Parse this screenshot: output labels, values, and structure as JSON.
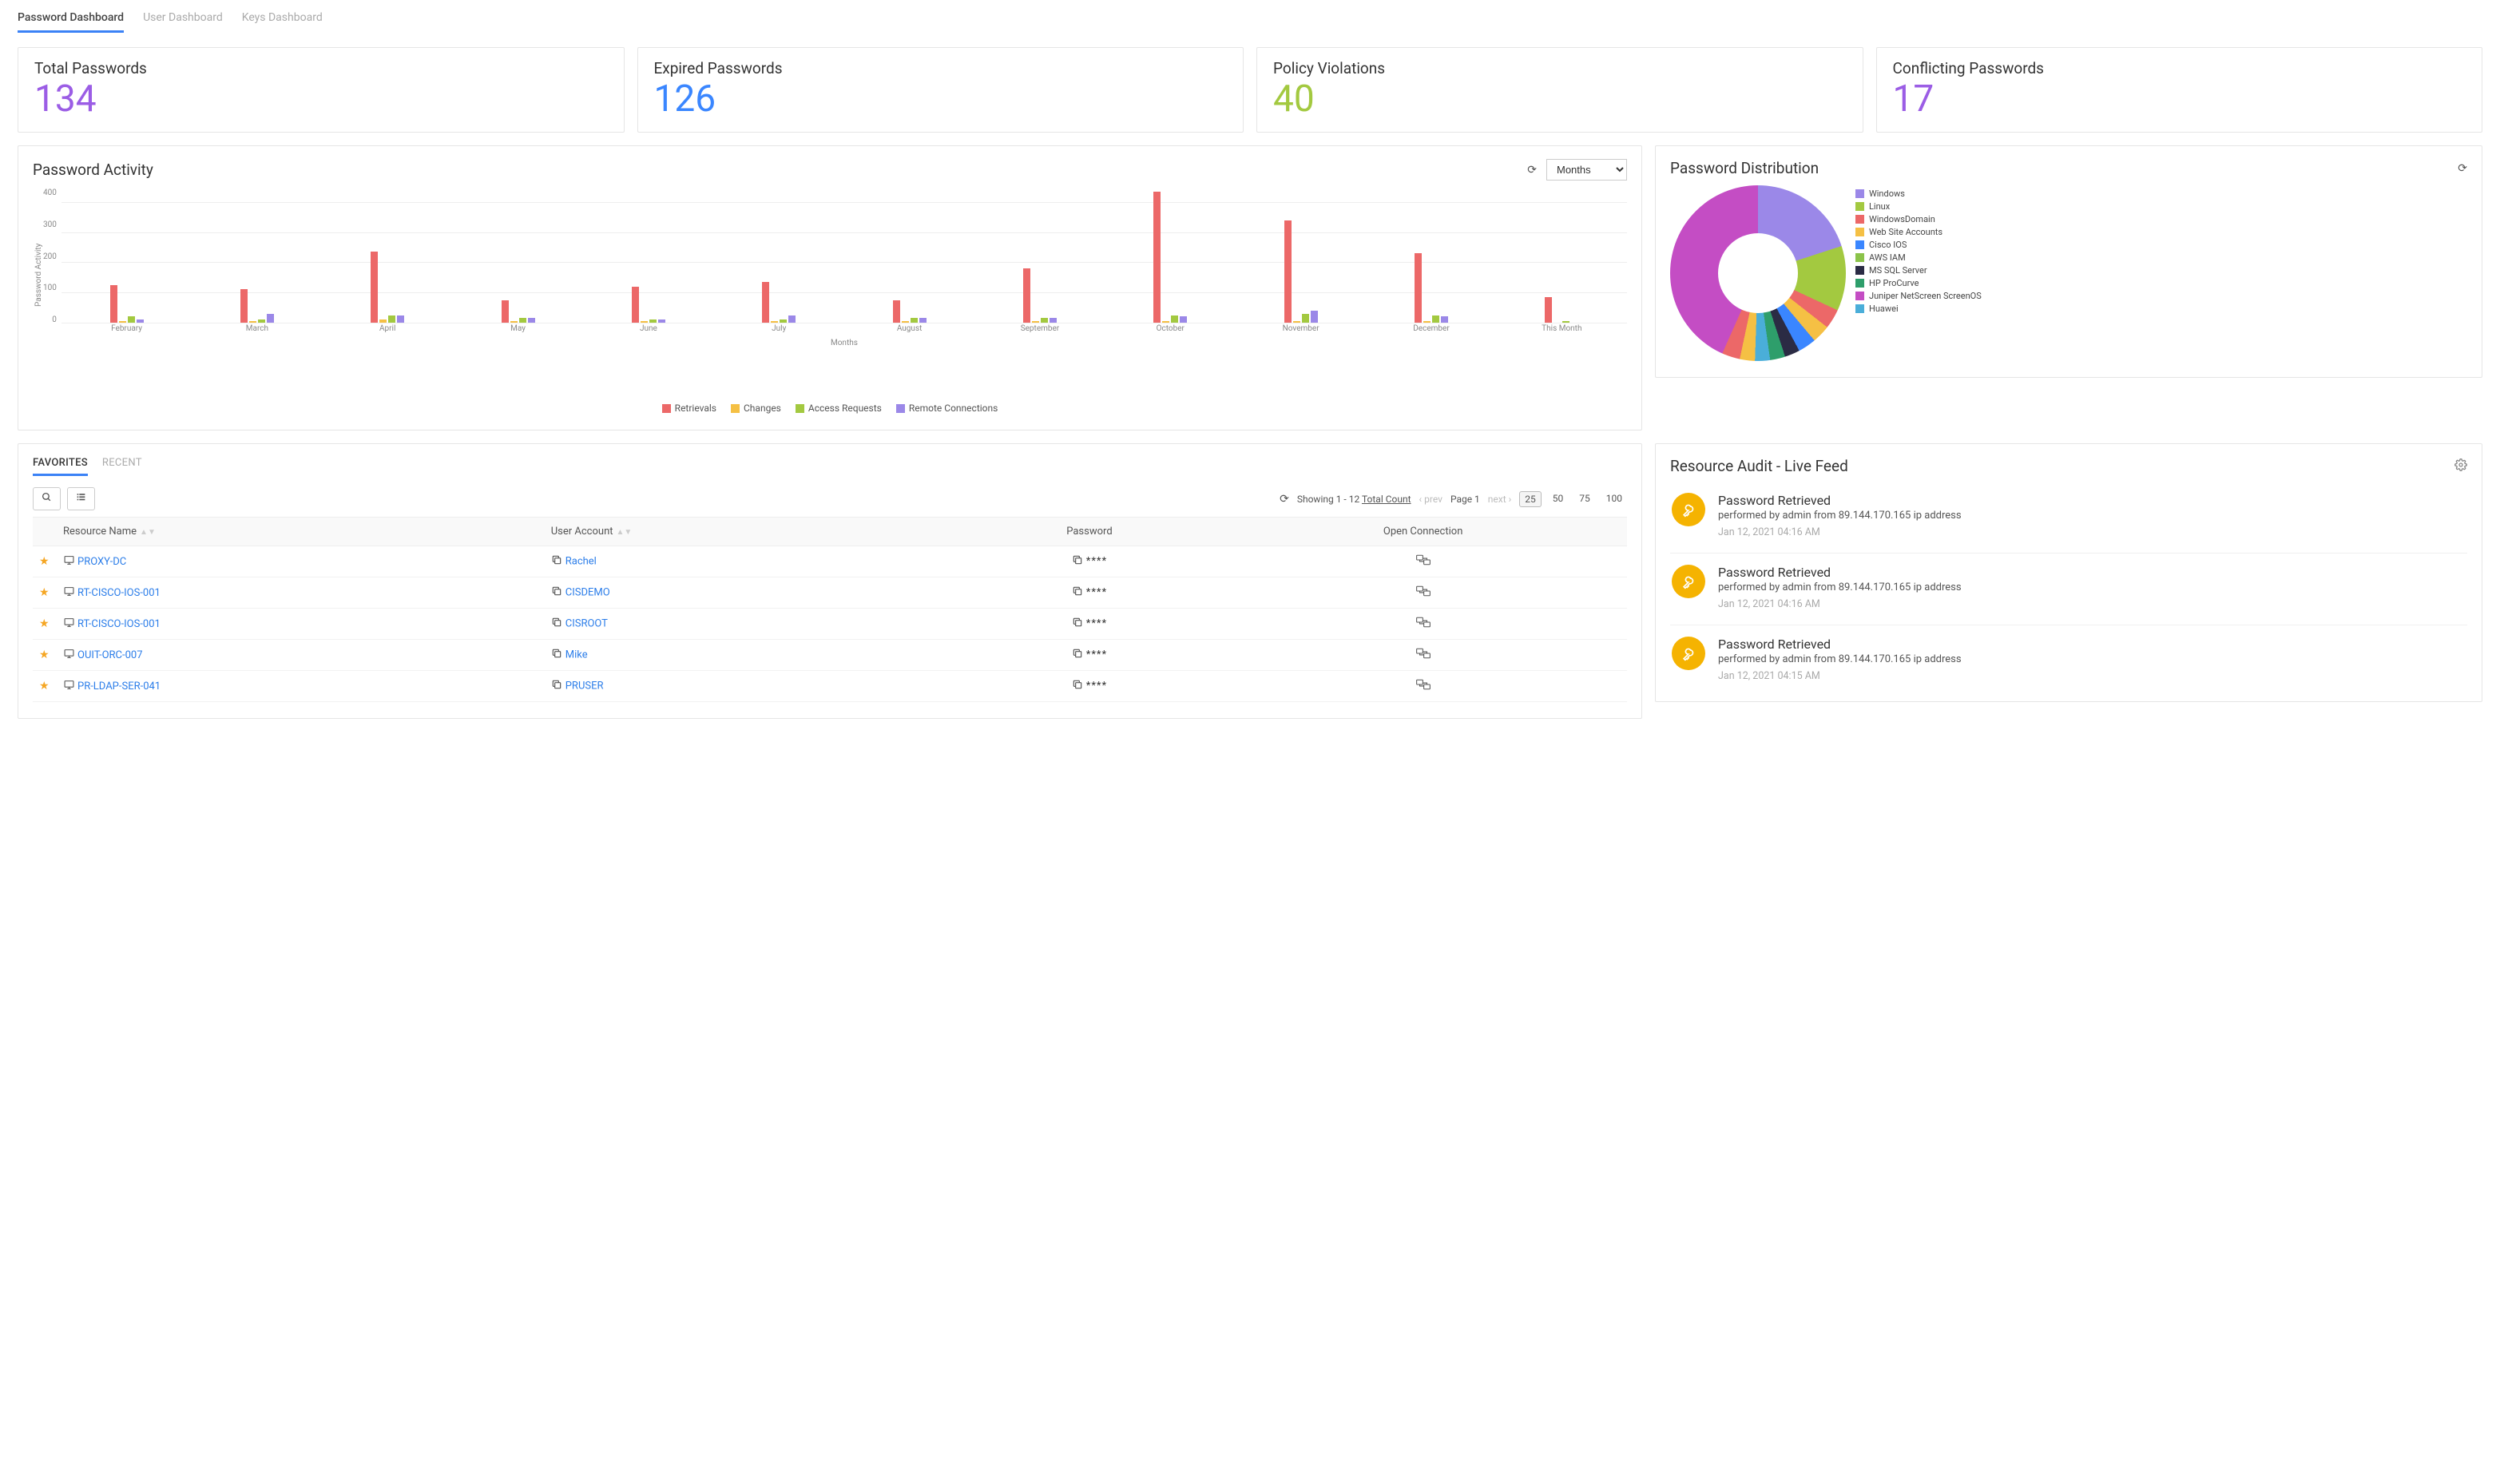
{
  "tabs": [
    "Password Dashboard",
    "User Dashboard",
    "Keys Dashboard"
  ],
  "stats": [
    {
      "label": "Total Passwords",
      "value": "134",
      "color": "c-purple"
    },
    {
      "label": "Expired Passwords",
      "value": "126",
      "color": "c-blue"
    },
    {
      "label": "Policy Violations",
      "value": "40",
      "color": "c-green"
    },
    {
      "label": "Conflicting Passwords",
      "value": "17",
      "color": "c-violet"
    }
  ],
  "activity": {
    "title": "Password Activity",
    "selector": "Months"
  },
  "chart_data": {
    "type": "bar",
    "title": "Password Activity",
    "xlabel": "Months",
    "ylabel": "Password Activity",
    "ylim": [
      0,
      450
    ],
    "yticks": [
      0,
      100,
      200,
      300,
      400
    ],
    "categories": [
      "February",
      "March",
      "April",
      "May",
      "June",
      "July",
      "August",
      "September",
      "October",
      "November",
      "December",
      "This Month"
    ],
    "series": [
      {
        "name": "Retrievals",
        "color": "#ec6868",
        "values": [
          125,
          110,
          235,
          75,
          120,
          135,
          75,
          180,
          435,
          340,
          230,
          85
        ]
      },
      {
        "name": "Changes",
        "color": "#f5c044",
        "values": [
          5,
          5,
          10,
          5,
          5,
          5,
          5,
          5,
          5,
          5,
          5,
          0
        ]
      },
      {
        "name": "Access Requests",
        "color": "#a3c940",
        "values": [
          20,
          10,
          25,
          15,
          10,
          10,
          15,
          15,
          25,
          30,
          25,
          5
        ]
      },
      {
        "name": "Remote Connections",
        "color": "#9b88e8",
        "values": [
          10,
          30,
          25,
          15,
          10,
          25,
          15,
          15,
          20,
          40,
          20,
          0
        ]
      }
    ]
  },
  "distribution": {
    "title": "Password Distribution",
    "legend": [
      {
        "label": "Windows",
        "color": "#9b88e8"
      },
      {
        "label": "Linux",
        "color": "#a3c940"
      },
      {
        "label": "WindowsDomain",
        "color": "#ec6868"
      },
      {
        "label": "Web Site Accounts",
        "color": "#f5c044"
      },
      {
        "label": "Cisco IOS",
        "color": "#3a86ff"
      },
      {
        "label": "AWS IAM",
        "color": "#8bc34a"
      },
      {
        "label": "MS SQL Server",
        "color": "#2b2b44"
      },
      {
        "label": "HP ProCurve",
        "color": "#2e9e6b"
      },
      {
        "label": "Juniper NetScreen ScreenOS",
        "color": "#c44dc4"
      },
      {
        "label": "Huawei",
        "color": "#4aaed9"
      }
    ]
  },
  "favorites": {
    "tabs": [
      "FAVORITES",
      "RECENT"
    ],
    "showing": "Showing 1 - 12",
    "total": "Total Count",
    "prev": "prev",
    "page": "Page 1",
    "next": "next",
    "sizes": [
      "25",
      "50",
      "75",
      "100"
    ],
    "columns": [
      "Resource Name",
      "User Account",
      "Password",
      "Open Connection"
    ],
    "rows": [
      {
        "resource": "PROXY-DC",
        "user": "Rachel",
        "pw": "****"
      },
      {
        "resource": "RT-CISCO-IOS-001",
        "user": "CISDEMO",
        "pw": "****"
      },
      {
        "resource": "RT-CISCO-IOS-001",
        "user": "CISROOT",
        "pw": "****"
      },
      {
        "resource": "OUIT-ORC-007",
        "user": "Mike",
        "pw": "****"
      },
      {
        "resource": "PR-LDAP-SER-041",
        "user": "PRUSER",
        "pw": "****"
      }
    ]
  },
  "audit": {
    "title": "Resource Audit - Live Feed",
    "items": [
      {
        "title": "Password Retrieved",
        "sub": "performed by admin from 89.144.170.165 ip address",
        "time": "Jan 12, 2021 04:16 AM"
      },
      {
        "title": "Password Retrieved",
        "sub": "performed by admin from 89.144.170.165 ip address",
        "time": "Jan 12, 2021 04:16 AM"
      },
      {
        "title": "Password Retrieved",
        "sub": "performed by admin from 89.144.170.165 ip address",
        "time": "Jan 12, 2021 04:15 AM"
      }
    ]
  }
}
